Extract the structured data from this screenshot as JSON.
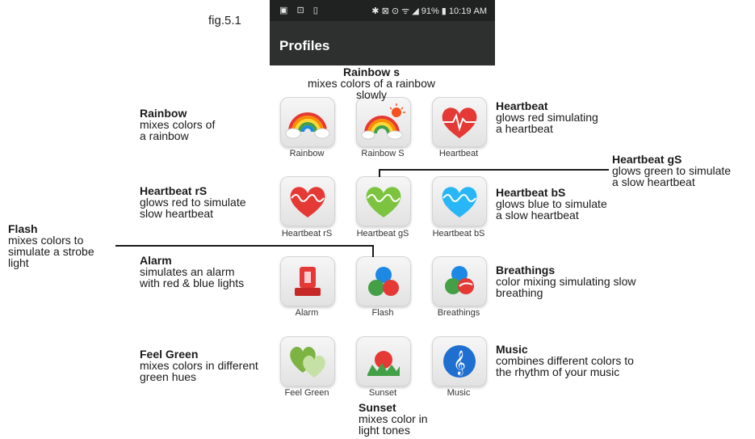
{
  "figure_label": "fig.5.1",
  "status_bar": {
    "left_icons": "▣ ⊡ ▯",
    "right": "✱ ⊠ ⊙ ᯤ ◢ 91% ▮ 10:19 AM"
  },
  "screen": {
    "title": "Profiles"
  },
  "profiles": [
    {
      "label": "Rainbow",
      "icon": "rainbow-icon"
    },
    {
      "label": "Rainbow S",
      "icon": "rainbow-sun-icon"
    },
    {
      "label": "Heartbeat",
      "icon": "heart-pulse-red-icon"
    },
    {
      "label": "Heartbeat rS",
      "icon": "heart-red-wave-icon"
    },
    {
      "label": "Heartbeat gS",
      "icon": "heart-green-wave-icon"
    },
    {
      "label": "Heartbeat bS",
      "icon": "heart-blue-wave-icon"
    },
    {
      "label": "Alarm",
      "icon": "alarm-light-icon"
    },
    {
      "label": "Flash",
      "icon": "color-circles-icon"
    },
    {
      "label": "Breathings",
      "icon": "breathing-circles-icon"
    },
    {
      "label": "Feel Green",
      "icon": "green-hearts-icon"
    },
    {
      "label": "Sunset",
      "icon": "sunset-icon"
    },
    {
      "label": "Music",
      "icon": "music-note-icon"
    }
  ],
  "annotations": [
    {
      "title": "Rainbow s",
      "desc": "mixes colors of a rainbow\nslowly"
    },
    {
      "title": "Rainbow",
      "desc": "mixes colors of\na rainbow"
    },
    {
      "title": "Heartbeat",
      "desc": "glows red simulating\na heartbeat"
    },
    {
      "title": "Heartbeat gS",
      "desc": "glows green to simulate\na slow heartbeat"
    },
    {
      "title": "Heartbeat rS",
      "desc": "glows red to simulate\nslow heartbeat"
    },
    {
      "title": "Heartbeat bS",
      "desc": "glows blue to simulate\na slow heartbeat"
    },
    {
      "title": "Flash",
      "desc": "mixes colors to\nsimulate a strobe\nlight"
    },
    {
      "title": "Alarm",
      "desc": "simulates an alarm\nwith red & blue lights"
    },
    {
      "title": "Breathings",
      "desc": "color mixing simulating slow\nbreathing"
    },
    {
      "title": "Feel Green",
      "desc": "mixes colors in different\ngreen hues"
    },
    {
      "title": "Music",
      "desc": "combines different colors to\nthe rhythm of your music"
    },
    {
      "title": "Sunset",
      "desc": "mixes color in\nlight tones"
    }
  ]
}
